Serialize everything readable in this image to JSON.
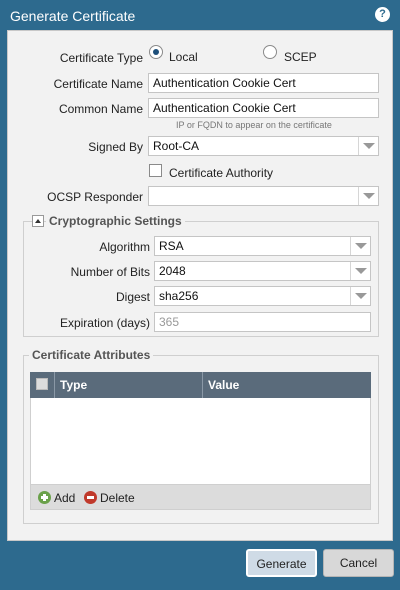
{
  "dialog": {
    "title": "Generate Certificate"
  },
  "form": {
    "cert_type_label": "Certificate Type",
    "cert_type_local": "Local",
    "cert_type_scep": "SCEP",
    "cert_type_selected": "Local",
    "cert_name_label": "Certificate Name",
    "cert_name_value": "Authentication Cookie Cert",
    "common_name_label": "Common Name",
    "common_name_value": "Authentication Cookie Cert",
    "common_name_hint": "IP or FQDN to appear on the certificate",
    "signed_by_label": "Signed By",
    "signed_by_value": "Root-CA",
    "cert_authority_label": "Certificate Authority",
    "cert_authority_checked": false,
    "ocsp_label": "OCSP Responder",
    "ocsp_value": ""
  },
  "crypto": {
    "legend": "Cryptographic Settings",
    "algorithm_label": "Algorithm",
    "algorithm_value": "RSA",
    "bits_label": "Number of Bits",
    "bits_value": "2048",
    "digest_label": "Digest",
    "digest_value": "sha256",
    "expiration_label": "Expiration (days)",
    "expiration_value": "365"
  },
  "attributes": {
    "legend": "Certificate Attributes",
    "columns": [
      "Type",
      "Value"
    ],
    "rows": [],
    "add_label": "Add",
    "delete_label": "Delete"
  },
  "footer": {
    "generate_label": "Generate",
    "cancel_label": "Cancel"
  },
  "colors": {
    "frame": "#2d6a8e",
    "panel": "#f2f2f2",
    "grid_header": "#5a6b7b",
    "add_icon": "#6aa14a",
    "delete_icon": "#c0392b"
  }
}
